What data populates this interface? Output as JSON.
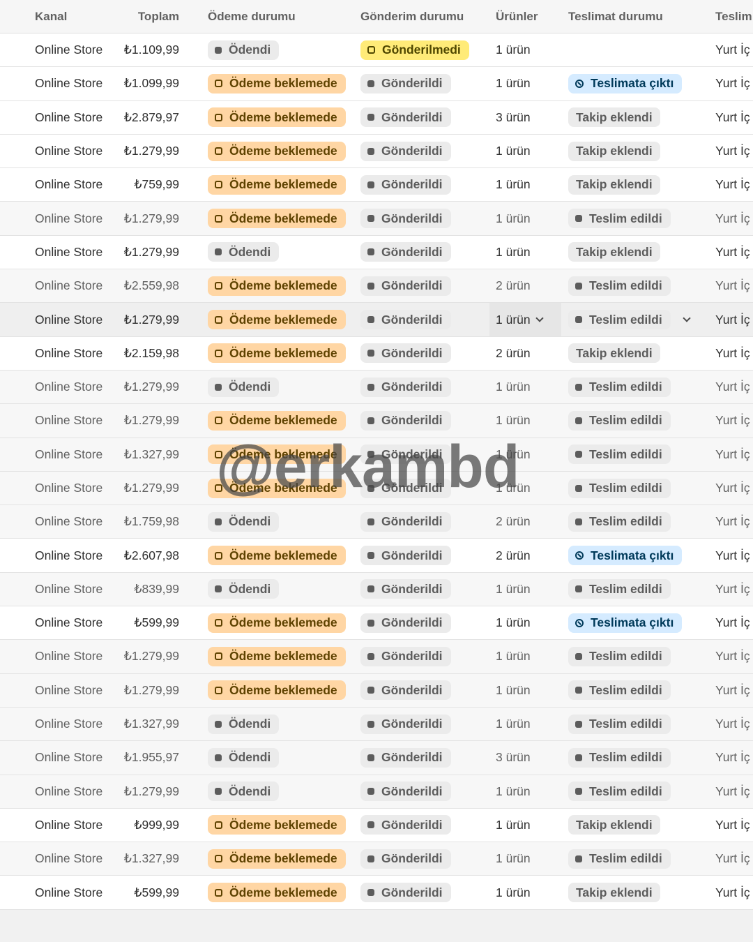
{
  "header": {
    "channel": "Kanal",
    "total": "Toplam",
    "payment": "Ödeme durumu",
    "shipment": "Gönderim durumu",
    "items": "Ürünler",
    "delivery": "Teslimat durumu",
    "method": "Teslim"
  },
  "status_colors": {
    "paid_grey": "#ebebeb",
    "pending_orange": "#ffd6a4",
    "unfulfilled_yellow": "#ffeb78",
    "out_for_delivery_blue": "#d5ebff"
  },
  "watermark": "@erkambd",
  "rows": [
    {
      "channel": "Online Store",
      "total": "₺1.109,99",
      "payment": "Ödendi",
      "shipment": "Gönderilmedi",
      "items": "1 ürün",
      "delivery": "",
      "method": "Yurt İç"
    },
    {
      "channel": "Online Store",
      "total": "₺1.099,99",
      "payment": "Ödeme beklemede",
      "shipment": "Gönderildi",
      "items": "1 ürün",
      "delivery": "Teslimata çıktı",
      "method": "Yurt İç"
    },
    {
      "channel": "Online Store",
      "total": "₺2.879,97",
      "payment": "Ödeme beklemede",
      "shipment": "Gönderildi",
      "items": "3 ürün",
      "delivery": "Takip eklendi",
      "method": "Yurt İç"
    },
    {
      "channel": "Online Store",
      "total": "₺1.279,99",
      "payment": "Ödeme beklemede",
      "shipment": "Gönderildi",
      "items": "1 ürün",
      "delivery": "Takip eklendi",
      "method": "Yurt İç"
    },
    {
      "channel": "Online Store",
      "total": "₺759,99",
      "payment": "Ödeme beklemede",
      "shipment": "Gönderildi",
      "items": "1 ürün",
      "delivery": "Takip eklendi",
      "method": "Yurt İç"
    },
    {
      "channel": "Online Store",
      "total": "₺1.279,99",
      "payment": "Ödeme beklemede",
      "shipment": "Gönderildi",
      "items": "1 ürün",
      "delivery": "Teslim edildi",
      "method": "Yurt İç"
    },
    {
      "channel": "Online Store",
      "total": "₺1.279,99",
      "payment": "Ödendi",
      "shipment": "Gönderildi",
      "items": "1 ürün",
      "delivery": "Takip eklendi",
      "method": "Yurt İç"
    },
    {
      "channel": "Online Store",
      "total": "₺2.559,98",
      "payment": "Ödeme beklemede",
      "shipment": "Gönderildi",
      "items": "2 ürün",
      "delivery": "Teslim edildi",
      "method": "Yurt İç"
    },
    {
      "channel": "Online Store",
      "total": "₺1.279,99",
      "payment": "Ödeme beklemede",
      "shipment": "Gönderildi",
      "items": "1 ürün",
      "delivery": "Teslim edildi",
      "method": "Yurt İç"
    },
    {
      "channel": "Online Store",
      "total": "₺2.159,98",
      "payment": "Ödeme beklemede",
      "shipment": "Gönderildi",
      "items": "2 ürün",
      "delivery": "Takip eklendi",
      "method": "Yurt İç"
    },
    {
      "channel": "Online Store",
      "total": "₺1.279,99",
      "payment": "Ödendi",
      "shipment": "Gönderildi",
      "items": "1 ürün",
      "delivery": "Teslim edildi",
      "method": "Yurt İç"
    },
    {
      "channel": "Online Store",
      "total": "₺1.279,99",
      "payment": "Ödeme beklemede",
      "shipment": "Gönderildi",
      "items": "1 ürün",
      "delivery": "Teslim edildi",
      "method": "Yurt İç"
    },
    {
      "channel": "Online Store",
      "total": "₺1.327,99",
      "payment": "Ödeme beklemede",
      "shipment": "Gönderildi",
      "items": "1 ürün",
      "delivery": "Teslim edildi",
      "method": "Yurt İç"
    },
    {
      "channel": "Online Store",
      "total": "₺1.279,99",
      "payment": "Ödeme beklemede",
      "shipment": "Gönderildi",
      "items": "1 ürün",
      "delivery": "Teslim edildi",
      "method": "Yurt İç"
    },
    {
      "channel": "Online Store",
      "total": "₺1.759,98",
      "payment": "Ödendi",
      "shipment": "Gönderildi",
      "items": "2 ürün",
      "delivery": "Teslim edildi",
      "method": "Yurt İç"
    },
    {
      "channel": "Online Store",
      "total": "₺2.607,98",
      "payment": "Ödeme beklemede",
      "shipment": "Gönderildi",
      "items": "2 ürün",
      "delivery": "Teslimata çıktı",
      "method": "Yurt İç"
    },
    {
      "channel": "Online Store",
      "total": "₺839,99",
      "payment": "Ödendi",
      "shipment": "Gönderildi",
      "items": "1 ürün",
      "delivery": "Teslim edildi",
      "method": "Yurt İç"
    },
    {
      "channel": "Online Store",
      "total": "₺599,99",
      "payment": "Ödeme beklemede",
      "shipment": "Gönderildi",
      "items": "1 ürün",
      "delivery": "Teslimata çıktı",
      "method": "Yurt İç"
    },
    {
      "channel": "Online Store",
      "total": "₺1.279,99",
      "payment": "Ödeme beklemede",
      "shipment": "Gönderildi",
      "items": "1 ürün",
      "delivery": "Teslim edildi",
      "method": "Yurt İç"
    },
    {
      "channel": "Online Store",
      "total": "₺1.279,99",
      "payment": "Ödeme beklemede",
      "shipment": "Gönderildi",
      "items": "1 ürün",
      "delivery": "Teslim edildi",
      "method": "Yurt İç"
    },
    {
      "channel": "Online Store",
      "total": "₺1.327,99",
      "payment": "Ödendi",
      "shipment": "Gönderildi",
      "items": "1 ürün",
      "delivery": "Teslim edildi",
      "method": "Yurt İç"
    },
    {
      "channel": "Online Store",
      "total": "₺1.955,97",
      "payment": "Ödendi",
      "shipment": "Gönderildi",
      "items": "3 ürün",
      "delivery": "Teslim edildi",
      "method": "Yurt İç"
    },
    {
      "channel": "Online Store",
      "total": "₺1.279,99",
      "payment": "Ödendi",
      "shipment": "Gönderildi",
      "items": "1 ürün",
      "delivery": "Teslim edildi",
      "method": "Yurt İç"
    },
    {
      "channel": "Online Store",
      "total": "₺999,99",
      "payment": "Ödeme beklemede",
      "shipment": "Gönderildi",
      "items": "1 ürün",
      "delivery": "Takip eklendi",
      "method": "Yurt İç"
    },
    {
      "channel": "Online Store",
      "total": "₺1.327,99",
      "payment": "Ödeme beklemede",
      "shipment": "Gönderildi",
      "items": "1 ürün",
      "delivery": "Teslim edildi",
      "method": "Yurt İç"
    },
    {
      "channel": "Online Store",
      "total": "₺599,99",
      "payment": "Ödeme beklemede",
      "shipment": "Gönderildi",
      "items": "1 ürün",
      "delivery": "Takip eklendi",
      "method": "Yurt İç"
    }
  ]
}
